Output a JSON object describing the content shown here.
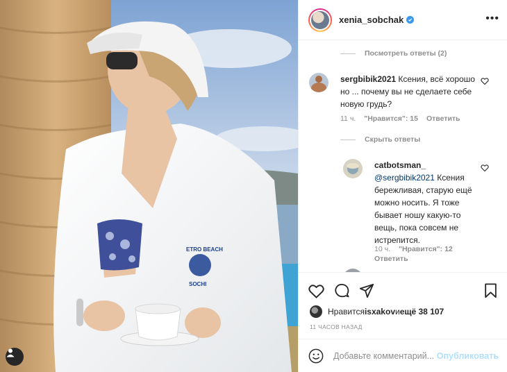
{
  "post": {
    "username": "xenia_sobchak",
    "verified": true,
    "more_icon": "•••"
  },
  "photo": {
    "pocket_text_top": "ETRO BEACH",
    "pocket_text_bottom": "SOCHI"
  },
  "comments": {
    "view_replies": "Посмотреть ответы (2)",
    "hide_replies": "Скрыть ответы",
    "items": [
      {
        "username": "sergbibik2021",
        "text": " Ксения, всё хорошо но ... почему вы не сделаете себе новую грудь?",
        "time": "11 ч.",
        "likes": "\"Нравится\": 15",
        "reply": "Ответить"
      },
      {
        "username": "catbotsman_",
        "mention": "@sergbibik2021",
        "text": " Ксения бережливая, старую ещё можно носить. Я тоже бывает ношу какую-то вещь, пока совсем не истрепится.",
        "time": "10 ч.",
        "likes": "\"Нравится\": 12",
        "reply": "Ответить"
      }
    ]
  },
  "likes": {
    "prefix": "Нравится ",
    "user": "isxakov",
    "middle": " и ",
    "others": "ещё 38 107"
  },
  "timestamp": "11 ЧАСОВ НАЗАД",
  "add_comment": {
    "placeholder": "Добавьте комментарий...",
    "publish": "Опубликовать"
  },
  "colors": {
    "accent": "#3897f0",
    "publish_disabled": "#b2dffc",
    "muted": "#8e8e8e",
    "text": "#262626"
  }
}
